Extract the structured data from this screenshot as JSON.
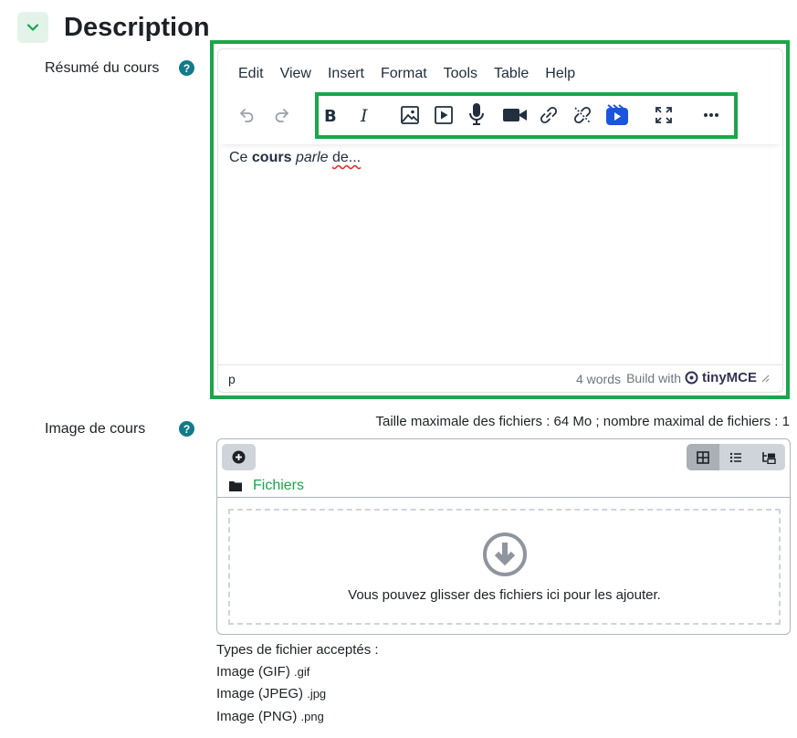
{
  "section": {
    "title": "Description",
    "expanded_icon": "chevron-down-icon"
  },
  "summary_field": {
    "label": "Résumé du cours",
    "help": "?",
    "editor": {
      "menu": [
        "Edit",
        "View",
        "Insert",
        "Format",
        "Tools",
        "Table",
        "Help"
      ],
      "toolbar": [
        "undo-icon",
        "redo-icon",
        "bold-icon",
        "italic-icon",
        "image-icon",
        "media-icon",
        "microphone-icon",
        "video-camera-icon",
        "link-icon",
        "unlink-icon",
        "h5p-icon",
        "fullscreen-icon",
        "more-icon"
      ],
      "content": {
        "t1": "Ce ",
        "bold": "cours",
        "t2": " ",
        "italic": "parle",
        "t3": " ",
        "rest": "de..."
      },
      "status_path": "p",
      "word_count": "4 words",
      "build_with": "Build with",
      "brand": "tinyMCE"
    }
  },
  "image_field": {
    "label": "Image de cours",
    "help": "?",
    "max_size": "Taille maximale des fichiers : 64 Mo ; nombre maximal de fichiers : 1",
    "path_label": "Fichiers",
    "drop_text": "Vous pouvez glisser des fichiers ici pour les ajouter.",
    "accepted_title": "Types de fichier acceptés :",
    "types": [
      {
        "name": "Image (GIF)",
        "ext": ".gif"
      },
      {
        "name": "Image (JPEG)",
        "ext": ".jpg"
      },
      {
        "name": "Image (PNG)",
        "ext": ".png"
      }
    ]
  },
  "colors": {
    "accent": "#1aa64a",
    "help": "#127a8a",
    "h5p": "#1a56db"
  }
}
